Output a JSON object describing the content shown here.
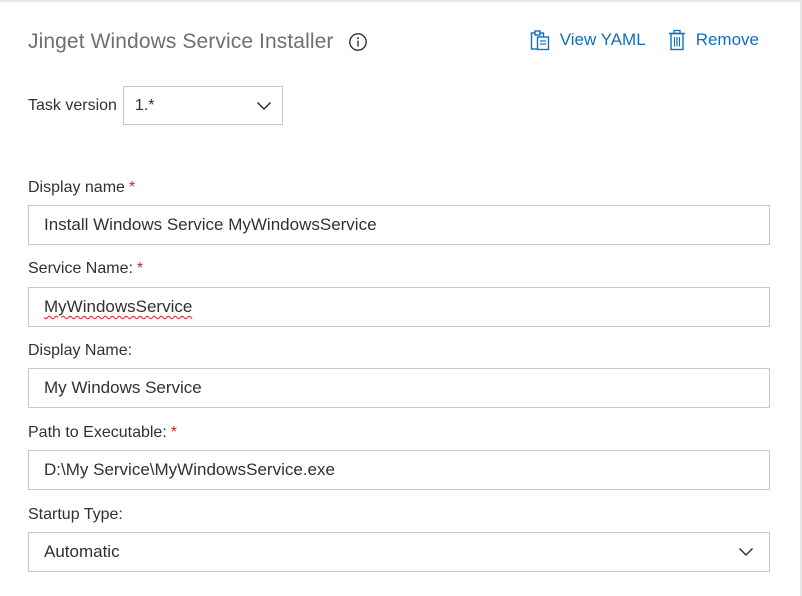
{
  "header": {
    "title": "Jinget Windows Service Installer",
    "view_yaml_label": "View YAML",
    "remove_label": "Remove"
  },
  "task_version": {
    "label": "Task version",
    "value": "1.*"
  },
  "fields": {
    "display_name": {
      "label": "Display name",
      "required": "*",
      "value": "Install Windows Service MyWindowsService"
    },
    "service_name": {
      "label": "Service Name:",
      "required": "*",
      "value": "MyWindowsService"
    },
    "display_name2": {
      "label": "Display Name:",
      "value": "My Windows Service"
    },
    "path": {
      "label": "Path to Executable:",
      "required": "*",
      "value": "D:\\My Service\\MyWindowsService.exe"
    },
    "startup_type": {
      "label": "Startup Type:",
      "value": "Automatic"
    }
  },
  "colors": {
    "accent": "#106ebe",
    "required": "#c42b1c",
    "border": "#c8c6c4"
  },
  "icons": {
    "info": "info-icon",
    "view_yaml": "clipboard-icon",
    "remove": "trash-icon",
    "dropdown": "chevron-down-icon"
  }
}
